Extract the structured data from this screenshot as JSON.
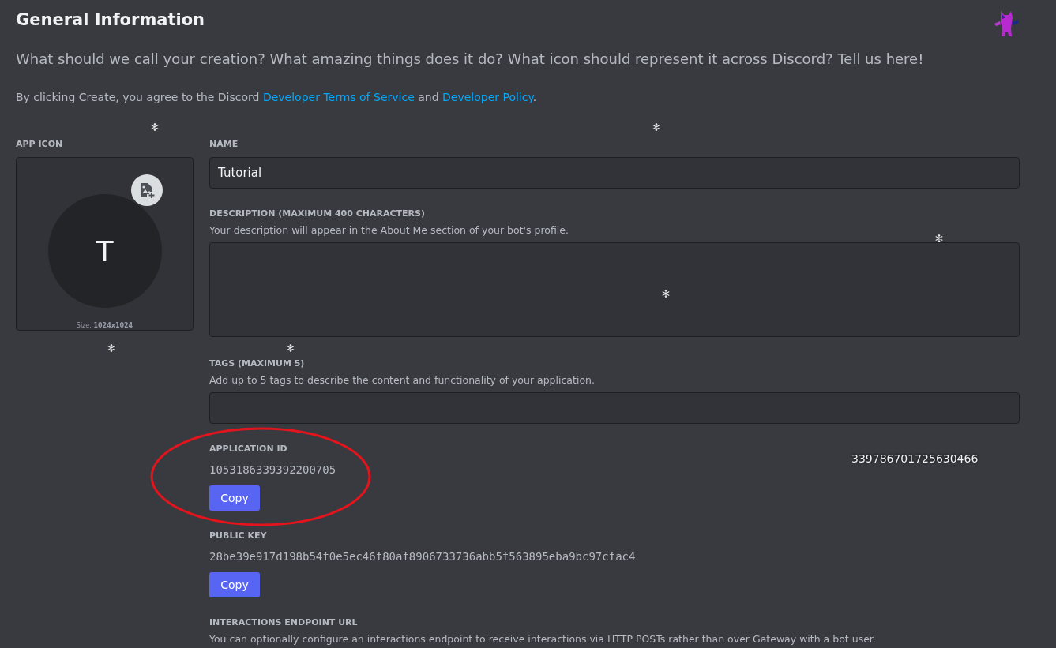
{
  "title": "General Information",
  "subtitle": "What should we call your creation? What amazing things does it do? What icon should represent it across Discord? Tell us here!",
  "terms": {
    "before": "By clicking Create, you agree to the Discord ",
    "link1": "Developer Terms of Service",
    "middle": " and ",
    "link2": "Developer Policy",
    "after": "."
  },
  "app_icon": {
    "label": "APP ICON",
    "initial": "T",
    "size_label": "Size:",
    "size_value": "1024x1024"
  },
  "fields": [
    {
      "kind": "input",
      "label": "NAME",
      "value": "Tutorial"
    },
    {
      "kind": "textarea",
      "label": "DESCRIPTION (MAXIMUM 400 CHARACTERS)",
      "help": "Your description will appear in the About Me section of your bot's profile."
    },
    {
      "kind": "input",
      "label": "TAGS (MAXIMUM 5)",
      "help": "Add up to 5 tags to describe the content and functionality of your application."
    },
    {
      "kind": "copy",
      "label": "APPLICATION ID",
      "value": "1053186339392200705",
      "button": "Copy"
    },
    {
      "kind": "copy",
      "label": "PUBLIC KEY",
      "value": "28be39e917d198b54f0e5ec46f80af8906733736abb5f563895eba9bc97cfac4",
      "button": "Copy"
    },
    {
      "kind": "info",
      "label": "INTERACTIONS ENDPOINT URL",
      "help": "You can optionally configure an interactions endpoint to receive interactions via HTTP POSTs rather than over Gateway with a bot user."
    }
  ],
  "overlay_id": "339786701725630466"
}
